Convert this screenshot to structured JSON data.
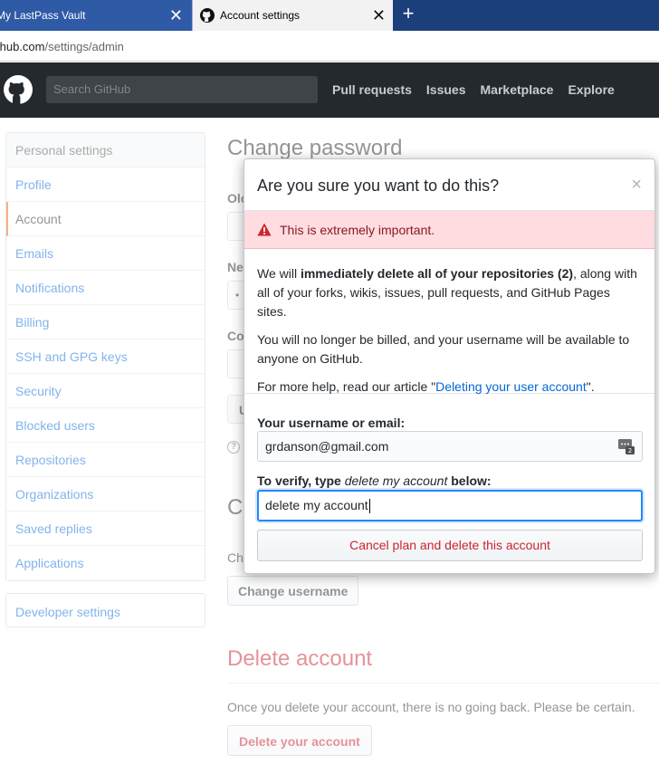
{
  "browser": {
    "tabs": [
      {
        "title": "My LastPass Vault"
      },
      {
        "title": "Account settings"
      }
    ],
    "address": {
      "host": "thub.com",
      "path": "/settings/admin"
    }
  },
  "header": {
    "search_placeholder": "Search GitHub",
    "nav": [
      "Pull requests",
      "Issues",
      "Marketplace",
      "Explore"
    ]
  },
  "sidebar": {
    "header": "Personal settings",
    "items": [
      "Profile",
      "Account",
      "Emails",
      "Notifications",
      "Billing",
      "SSH and GPG keys",
      "Security",
      "Blocked users",
      "Repositories",
      "Organizations",
      "Saved replies",
      "Applications"
    ],
    "selected": "Account",
    "developer": "Developer settings"
  },
  "main": {
    "change_password_title": "Change password",
    "partial_labels": [
      "Olo",
      "Ne",
      "Co"
    ],
    "partial_input_dot": "•",
    "partial_button": "U",
    "change_username_partial_title": "Cl",
    "change_username_partial_text": "Ch",
    "change_username_button": "Change username",
    "delete_title": "Delete account",
    "delete_desc": "Once you delete your account, there is no going back. Please be certain.",
    "delete_button": "Delete your account"
  },
  "modal": {
    "title": "Are you sure you want to do this?",
    "close": "×",
    "flash": "This is extremely important.",
    "p1_a": "We will ",
    "p1_b": "immediately delete all of your repositories (2)",
    "p1_c": ", along with all of your forks, wikis, issues, pull requests, and GitHub Pages sites.",
    "p2": "You will no longer be billed, and your username will be available to anyone on GitHub.",
    "p3_a": "For more help, read our article \"",
    "p3_link": "Deleting your user account",
    "p3_b": "\".",
    "username_label": "Your username or email:",
    "username_value": "grdanson@gmail.com",
    "verify_label_a": "To verify, type ",
    "verify_label_em": "delete my account",
    "verify_label_b": " below:",
    "verify_value": "delete my account",
    "submit": "Cancel plan and delete this account"
  },
  "colors": {
    "danger": "#cb2431",
    "link": "#0366d6",
    "header_bg": "#24292e",
    "flash_bg": "#ffdce0",
    "tab_bar": "#1b3f7a"
  }
}
